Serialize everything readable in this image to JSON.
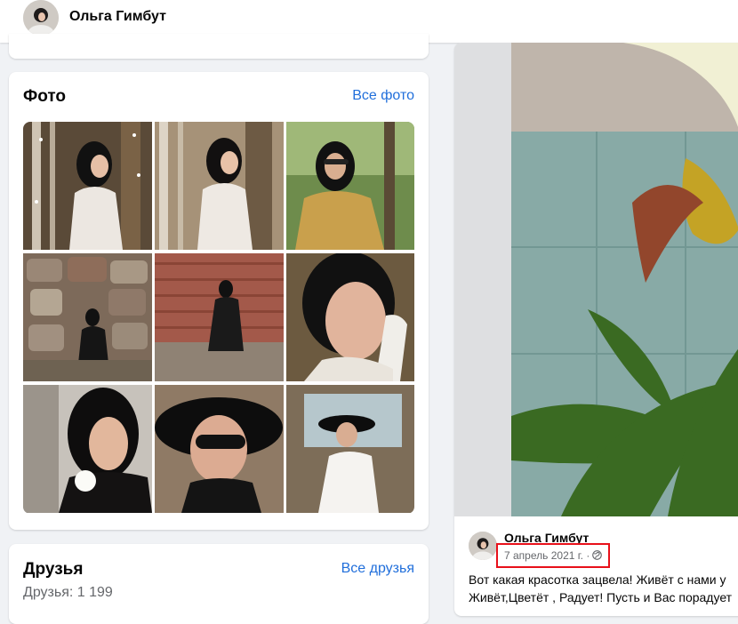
{
  "header": {
    "profile_name": "Ольга Гимбут"
  },
  "photos": {
    "title": "Фото",
    "all_link": "Все фото",
    "tiles": [
      {
        "desc": "woman in white coat by tree, sparkles"
      },
      {
        "desc": "woman in white coat by tree"
      },
      {
        "desc": "woman in yellow jacket with sunglasses"
      },
      {
        "desc": "woman in black outfit on stone wall"
      },
      {
        "desc": "woman in black sitting on rocks by brick wall"
      },
      {
        "desc": "close-up portrait with white glove"
      },
      {
        "desc": "woman holding white rose"
      },
      {
        "desc": "woman in black wide-brim hat"
      },
      {
        "desc": "woman in white dress and black hat on terrace"
      }
    ]
  },
  "friends": {
    "title": "Друзья",
    "all_link": "Все друзья",
    "count_text": "Друзья: 1 199"
  },
  "post": {
    "author": "Ольга Гимбут",
    "date": "7 апрель 2021 г. ·",
    "text_line1": "Вот какая красотка зацвела! Живёт с нами у",
    "text_line2": "Живёт,Цветёт , Радует! Пусть и Вас порадует"
  },
  "colors": {
    "link": "#216fdb",
    "highlight": "#e8101a",
    "secondary_text": "#65676b"
  }
}
